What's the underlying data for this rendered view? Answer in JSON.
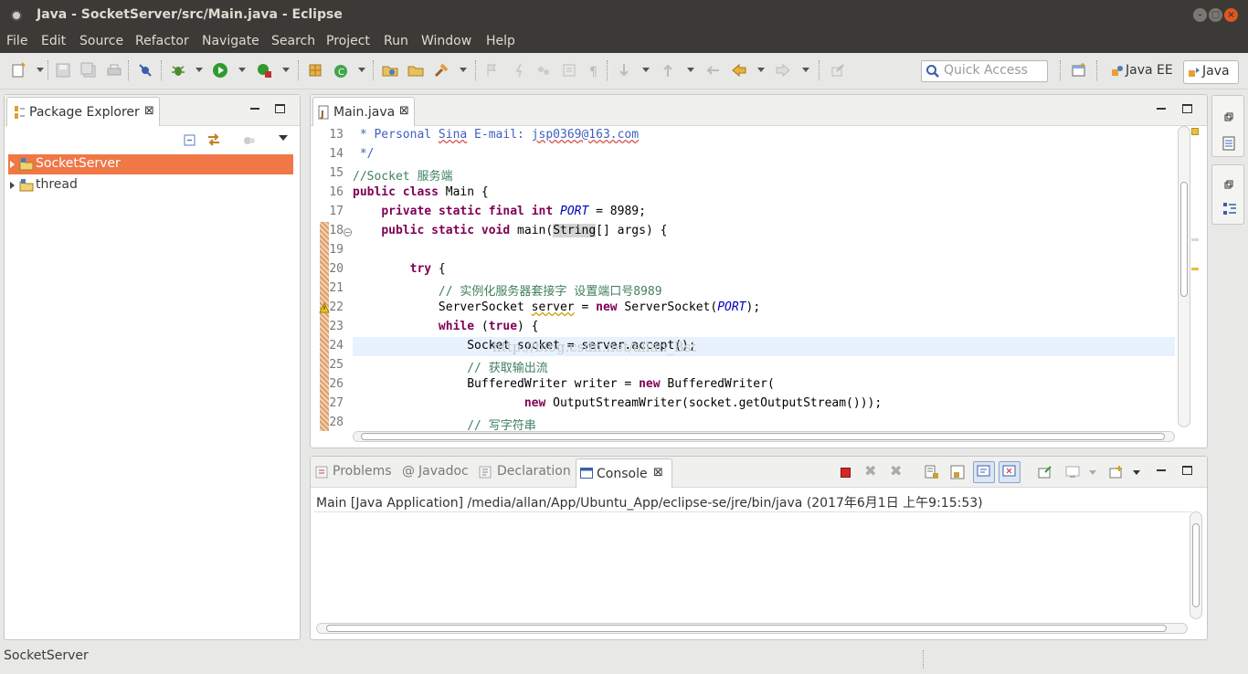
{
  "window": {
    "title": "Java - SocketServer/src/Main.java - Eclipse"
  },
  "menu": [
    "File",
    "Edit",
    "Source",
    "Refactor",
    "Navigate",
    "Search",
    "Project",
    "Run",
    "Window",
    "Help"
  ],
  "toolbar": {
    "quick_access_placeholder": "Quick Access",
    "perspectives": [
      "Java EE",
      "Java"
    ]
  },
  "package_explorer": {
    "tab_label": "Package Explorer",
    "projects": [
      {
        "name": "SocketServer",
        "selected": true
      },
      {
        "name": "thread",
        "selected": false
      }
    ]
  },
  "editor": {
    "tab_label": "Main.java",
    "watermark": "http://blog.csdn.net/allan_Bst",
    "lines": [
      {
        "n": "13",
        "tokens": [
          [
            "jd",
            " * Personal "
          ],
          [
            "jdw",
            "Sina"
          ],
          [
            "jd",
            " E-mail: "
          ],
          [
            "jdw",
            "jsp0369@163.com"
          ]
        ]
      },
      {
        "n": "14",
        "tokens": [
          [
            "jd",
            " */"
          ]
        ]
      },
      {
        "n": "15",
        "tokens": [
          [
            "cm",
            "//Socket 服务端"
          ]
        ]
      },
      {
        "n": "16",
        "tokens": [
          [
            "kw",
            "public"
          ],
          [
            "",
            " "
          ],
          [
            "kw",
            "class"
          ],
          [
            "",
            " Main {"
          ]
        ]
      },
      {
        "n": "17",
        "tokens": [
          [
            "",
            "    "
          ],
          [
            "kw",
            "private"
          ],
          [
            "",
            " "
          ],
          [
            "kw",
            "static"
          ],
          [
            "",
            " "
          ],
          [
            "kw",
            "final"
          ],
          [
            "",
            " "
          ],
          [
            "kw",
            "int"
          ],
          [
            "",
            " "
          ],
          [
            "cst",
            "PORT"
          ],
          [
            "",
            " = 8989;"
          ]
        ]
      },
      {
        "n": "18",
        "tokens": [
          [
            "",
            "    "
          ],
          [
            "kw",
            "public"
          ],
          [
            "",
            " "
          ],
          [
            "kw",
            "static"
          ],
          [
            "",
            " "
          ],
          [
            "kw",
            "void"
          ],
          [
            "",
            " main("
          ],
          [
            "hl",
            "String"
          ],
          [
            "",
            "[] args) {"
          ]
        ]
      },
      {
        "n": "19",
        "tokens": []
      },
      {
        "n": "20",
        "tokens": [
          [
            "",
            "        "
          ],
          [
            "kw",
            "try"
          ],
          [
            "",
            " {"
          ]
        ]
      },
      {
        "n": "21",
        "tokens": [
          [
            "",
            "            "
          ],
          [
            "cm",
            "// 实例化服务器套接字 设置端口号8989"
          ]
        ]
      },
      {
        "n": "22",
        "tokens": [
          [
            "",
            "            ServerSocket "
          ],
          [
            "warn",
            "server"
          ],
          [
            "",
            " = "
          ],
          [
            "kw",
            "new"
          ],
          [
            "",
            " ServerSocket("
          ],
          [
            "cst",
            "PORT"
          ],
          [
            "",
            ");"
          ]
        ]
      },
      {
        "n": "23",
        "tokens": [
          [
            "",
            "            "
          ],
          [
            "kw",
            "while"
          ],
          [
            "",
            " ("
          ],
          [
            "kw",
            "true"
          ],
          [
            "",
            ") {"
          ]
        ]
      },
      {
        "n": "24",
        "tokens": [
          [
            "",
            "                Socket socket = server.accept();"
          ]
        ]
      },
      {
        "n": "25",
        "tokens": [
          [
            "",
            "                "
          ],
          [
            "cm",
            "// 获取输出流"
          ]
        ]
      },
      {
        "n": "26",
        "tokens": [
          [
            "",
            "                BufferedWriter writer = "
          ],
          [
            "kw",
            "new"
          ],
          [
            "",
            " BufferedWriter("
          ]
        ]
      },
      {
        "n": "27",
        "tokens": [
          [
            "",
            "                        "
          ],
          [
            "kw",
            "new"
          ],
          [
            "",
            " OutputStreamWriter(socket.getOutputStream()));"
          ]
        ]
      },
      {
        "n": "28",
        "tokens": [
          [
            "",
            "                "
          ],
          [
            "cm",
            "// 写字符串"
          ]
        ]
      }
    ]
  },
  "bottom_panel": {
    "tabs": [
      "Problems",
      "Javadoc",
      "Declaration",
      "Console"
    ],
    "active_tab": "Console",
    "status_line": "Main [Java Application] /media/allan/App/Ubuntu_App/eclipse-se/jre/bin/java (2017年6月1日 上午9:15:53)"
  },
  "statusbar": {
    "selection": "SocketServer"
  },
  "colors": {
    "titlebar": "#3b3a36",
    "selection": "#f07746",
    "keyword": "#7f0055",
    "comment": "#3f7f5f",
    "javadoc": "#3f5fbf",
    "constant": "#0000c0",
    "current_line": "#e8f2fe"
  },
  "icons": [
    "package-icon",
    "project-icon",
    "java-file-icon",
    "search-icon",
    "terminate-icon",
    "minimize-icon",
    "maximize-icon"
  ]
}
